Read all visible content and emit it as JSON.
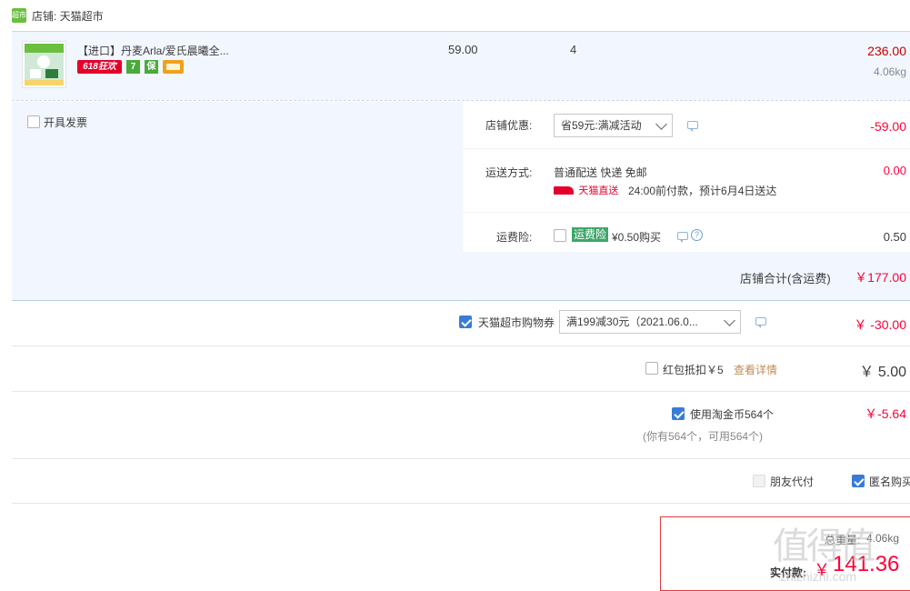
{
  "shop": {
    "icon_text": "超市",
    "label": "店铺: 天猫超市"
  },
  "item": {
    "title": "【进口】丹麦Arla/爱氏晨曦全...",
    "price": "59.00",
    "quantity": "4",
    "subtotal": "236.00",
    "weight": "4.06kg",
    "badges": [
      {
        "name": "promo-618-badge",
        "text": "618狂欢",
        "color": "#e4002b"
      },
      {
        "name": "seven-day-return-badge",
        "text": "7",
        "color": "#4aaa3a"
      },
      {
        "name": "guarantee-badge",
        "text": "保",
        "color": "#4aaa3a"
      },
      {
        "name": "card-pay-badge",
        "text": "",
        "color": "#f0a020"
      }
    ]
  },
  "invoice": {
    "label": "开具发票",
    "checked": false
  },
  "store_discount": {
    "label": "店铺优惠:",
    "select_value": "省59元:满减活动",
    "amount": "-59.00"
  },
  "shipping": {
    "label": "运送方式:",
    "method": "普通配送 快递 免邮",
    "brand_text": "天猫直送",
    "eta": "24:00前付款，预计6月4日送达",
    "amount": "0.00"
  },
  "insurance": {
    "label": "运费险:",
    "tag": "运费险",
    "price": "¥0.50购买",
    "amount": "0.50",
    "checked": false
  },
  "store_total": {
    "label": "店铺合计(含运费)",
    "amount": "￥177.00"
  },
  "coupon": {
    "label": "天猫超市购物券",
    "select_value": "满199减30元（2021.06.0...",
    "amount": "￥ -30.00",
    "checked": true
  },
  "red_packet": {
    "label": "红包抵扣￥5",
    "link": "查看详情",
    "amount": "￥ 5.00",
    "checked": false
  },
  "taojinbi": {
    "label": "使用淘金币564个",
    "note": "(你有564个，可用564个)",
    "amount": "￥-5.64",
    "checked": true
  },
  "options": {
    "friend_pay": {
      "label": "朋友代付",
      "checked": false,
      "disabled": true
    },
    "anonymous": {
      "label": "匿名购买",
      "checked": true
    }
  },
  "summary": {
    "weight_label": "总重量:",
    "weight_value": "4.06kg",
    "pay_label": "实付款:",
    "currency": "￥",
    "pay_amount": "141.36"
  },
  "watermark": {
    "text": "值 得 值",
    "url": "zhizhizhi.com"
  },
  "colors": {
    "accent_blue": "#3a7bd5",
    "price_red": "#ff0036",
    "section_bg": "#f2f7ff",
    "border_red": "#e4393c"
  }
}
